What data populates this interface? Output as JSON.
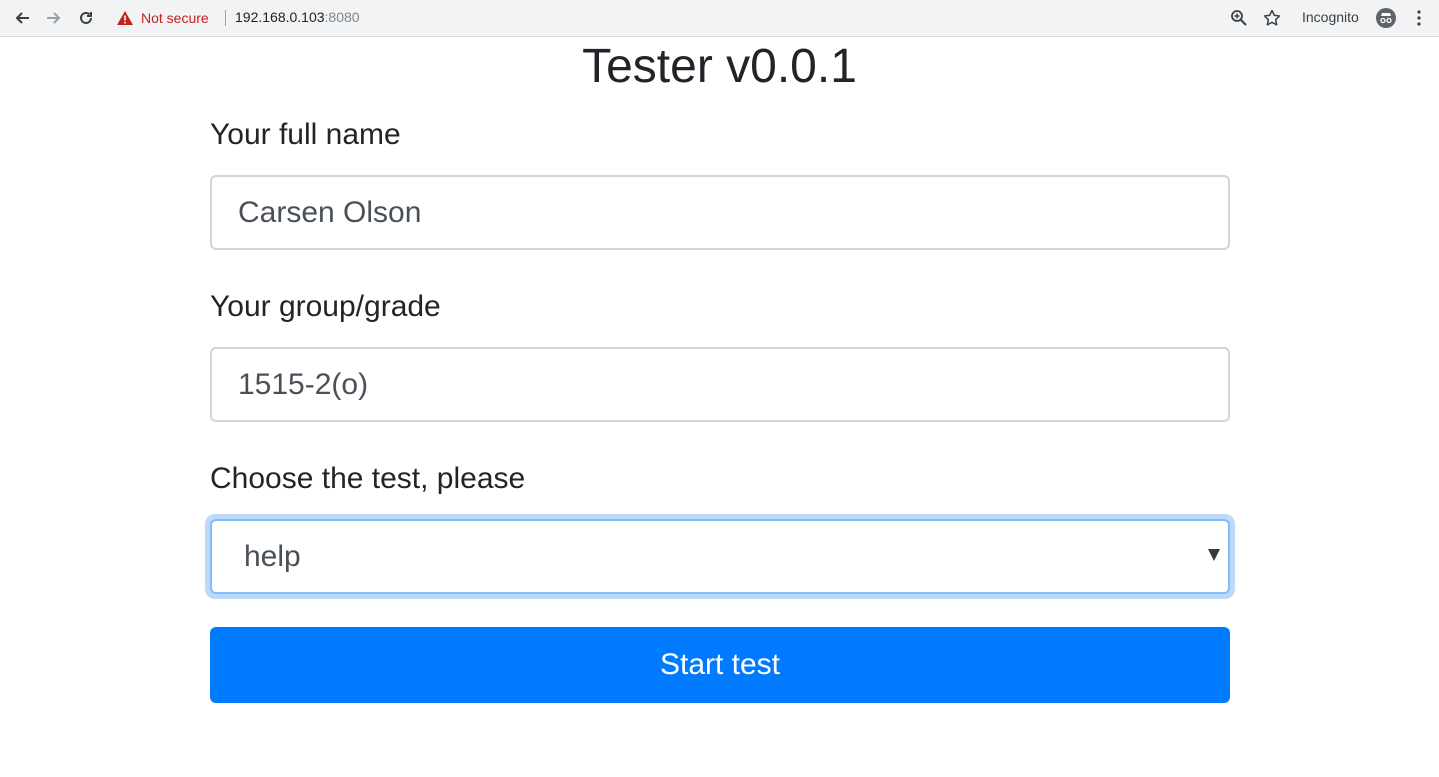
{
  "browser": {
    "security_text": "Not secure",
    "url_host": "192.168.0.103",
    "url_port": ":8080",
    "incognito_label": "Incognito"
  },
  "page": {
    "title": "Tester v0.0.1",
    "name_label": "Your full name",
    "name_value": "Carsen Olson",
    "group_label": "Your group/grade",
    "group_value": "1515-2(o)",
    "test_label": "Choose the test, please",
    "test_selected": "help",
    "start_button": "Start test"
  },
  "colors": {
    "primary": "#007bff",
    "focus_ring": "#bcd9f7",
    "warning": "#c5221f"
  }
}
